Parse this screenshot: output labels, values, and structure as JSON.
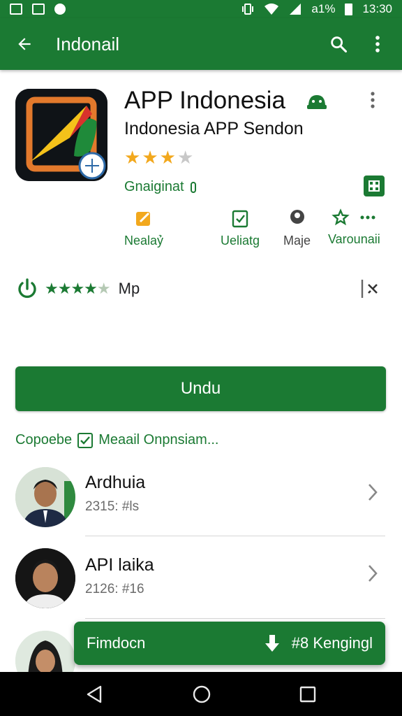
{
  "status_bar": {
    "signal_text": "a1%",
    "time": "13:30"
  },
  "app_bar": {
    "title": "Indonail",
    "back_icon": "arrow-left-icon",
    "search_icon": "search-icon",
    "menu_icon": "more-vert-icon"
  },
  "app": {
    "name": "APP Indonesia",
    "developer": "Indonesia APP Sendon",
    "star_rating": 3,
    "star_max": 4,
    "category": "Gnaiginat",
    "accent_color": "#1b7a33"
  },
  "quick_actions": [
    {
      "label": "Nealaỷ",
      "icon": "edit-icon"
    },
    {
      "label": "Ueliatg",
      "icon": "clipboard-check-icon"
    },
    {
      "label": "Maje",
      "icon": "person-icon"
    },
    {
      "label": "Varounaii",
      "icon": "star-outline-icon"
    }
  ],
  "rating_row": {
    "rating_label": "Mp",
    "stars_filled": 4
  },
  "install": {
    "label": "Undu"
  },
  "section": {
    "left": "Copoebe",
    "right": "Meaail Onpnsiam..."
  },
  "list": [
    {
      "name": "Ardhuia",
      "sub": "2315: #ls"
    },
    {
      "name": "API laika",
      "sub": "2126: #16"
    },
    {
      "name": "",
      "sub": ""
    }
  ],
  "snackbar": {
    "text": "Fimdocn",
    "action": "#8 Kengingl"
  }
}
